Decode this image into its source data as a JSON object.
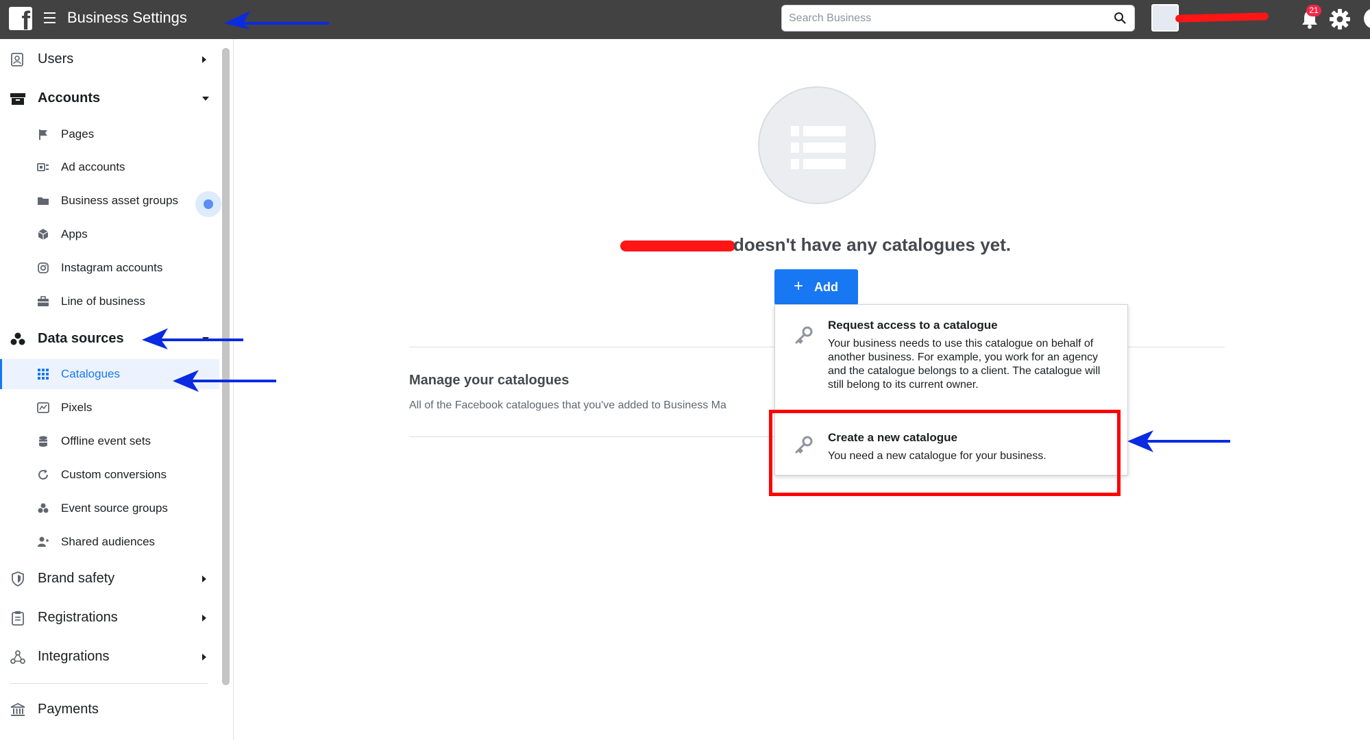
{
  "header": {
    "app_title": "Business Settings",
    "search_placeholder": "Search Business",
    "notification_count": "21"
  },
  "sidebar": {
    "users": "Users",
    "accounts": "Accounts",
    "accounts_items": [
      "Pages",
      "Ad accounts",
      "Business asset groups",
      "Apps",
      "Instagram accounts",
      "Line of business"
    ],
    "data_sources": "Data sources",
    "data_sources_items": [
      "Catalogues",
      "Pixels",
      "Offline event sets",
      "Custom conversions",
      "Event source groups",
      "Shared audiences"
    ],
    "brand_safety": "Brand safety",
    "registrations": "Registrations",
    "integrations": "Integrations",
    "payments": "Payments"
  },
  "main": {
    "empty_message": "doesn't have any catalogues yet.",
    "add_label": "Add",
    "manage_title": "Manage your catalogues",
    "manage_desc": "All of the Facebook catalogues that you've added to Business Ma"
  },
  "dropdown": {
    "options": [
      {
        "title": "Request access to a catalogue",
        "description": "Your business needs to use this catalogue on behalf of another business. For example, you work for an agency and the catalogue belongs to a client. The catalogue will still belong to its current owner."
      },
      {
        "title": "Create a new catalogue",
        "description": "You need a new catalogue for your business."
      }
    ]
  },
  "colors": {
    "topbar": "#424242",
    "accent": "#1877f2",
    "annotation_arrow": "#0a2be0",
    "annotation_highlight": "#ff0000"
  },
  "icons": {
    "logo": "facebook-logo",
    "menu": "hamburger-icon",
    "search": "search-icon",
    "notifications": "bell-icon",
    "settings": "gear-icon"
  }
}
